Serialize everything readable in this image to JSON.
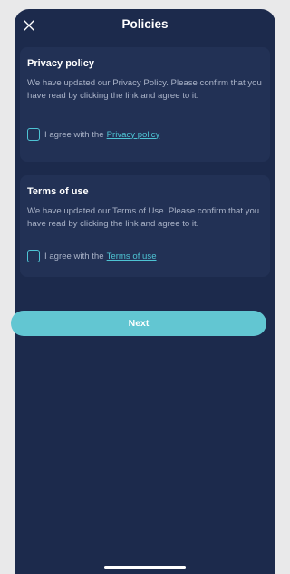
{
  "header": {
    "title": "Policies"
  },
  "privacy": {
    "title": "Privacy policy",
    "text": "We have updated our Privacy Policy. Please confirm that you have read by clicking the link and agree to it.",
    "agree_prefix": "I agree with the",
    "link": "Privacy policy",
    "checked": false
  },
  "terms": {
    "title": "Terms of use",
    "text": "We have updated our Terms of Use. Please confirm that you have read by clicking the link and agree to it.",
    "agree_prefix": "I agree with the",
    "link": "Terms of use",
    "checked": false
  },
  "next_label": "Next",
  "colors": {
    "background": "#1c2a4c",
    "card": "#223155",
    "accent": "#4ec4d4",
    "button": "#62c6d2"
  }
}
